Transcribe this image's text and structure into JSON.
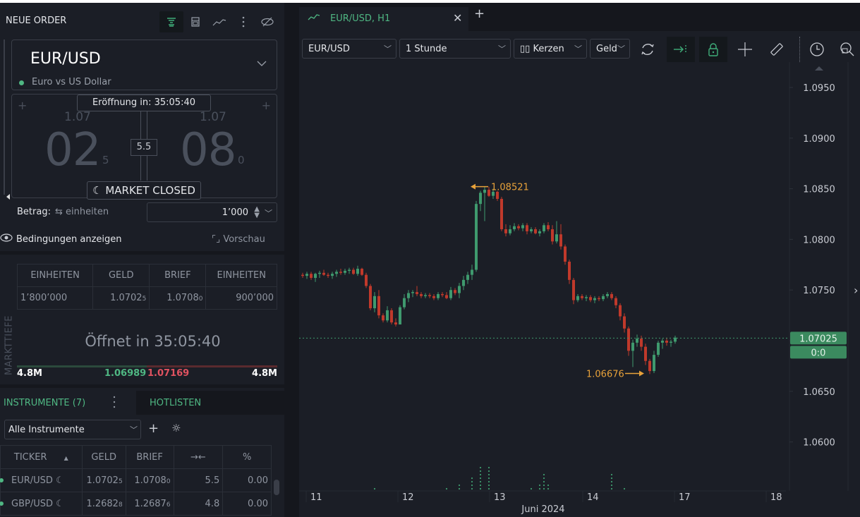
{
  "order_panel": {
    "title": "NEUE ORDER",
    "header_icons": [
      "order-book-icon",
      "calculator-icon",
      "chart-line-icon",
      "more-vertical-icon",
      "hide-eye-icon"
    ],
    "instrument": {
      "symbol": "EUR/USD",
      "description": "Euro vs US Dollar",
      "status_color": "#4fb783"
    },
    "quote": {
      "opening_label": "Eröffnung in: 35:05:40",
      "bid": {
        "prefix": "1.07",
        "pips": "02",
        "fraction": "5"
      },
      "ask": {
        "prefix": "1.07",
        "pips": "08",
        "fraction": "0"
      },
      "spread": "5.5",
      "market_status": "MARKET CLOSED",
      "market_status_icon": "moon-icon"
    },
    "amount": {
      "label": "Betrag:",
      "unit_toggle": "einheiten",
      "value": "1’000"
    },
    "conditions_label": "Bedingungen anzeigen",
    "preview_label": "Vorschau"
  },
  "market_depth": {
    "side_label": "MARKTTIEFE",
    "columns": [
      "EINHEITEN",
      "GELD",
      "BRIEF",
      "EINHEITEN"
    ],
    "rows": [
      {
        "bid_units": "1’800’000",
        "bid": "1.0702",
        "bid_frac": "5",
        "ask": "1.0708",
        "ask_frac": "0",
        "ask_units": "900’000"
      }
    ],
    "opens_in": "Öffnet in 35:05:40",
    "bid_volume": "4.8M",
    "bid_price": "1.06989",
    "ask_price": "1.07169",
    "ask_volume": "4.8M"
  },
  "instruments": {
    "tab_label": "INSTRUMENTE (7)",
    "hotlists_label": "HOTLISTEN",
    "filter": "Alle Instrumente",
    "columns": [
      "TICKER",
      "GELD",
      "BRIEF",
      "→←",
      "%"
    ],
    "rows": [
      {
        "ticker": "EUR/USD",
        "bid": "1.0702",
        "bid_frac": "5",
        "ask": "1.0708",
        "ask_frac": "0",
        "spread": "5.5",
        "change": "0.00"
      },
      {
        "ticker": "GBP/USD",
        "bid": "1.2682",
        "bid_frac": "8",
        "ask": "1.2687",
        "ask_frac": "6",
        "spread": "4.8",
        "change": "0.00"
      }
    ]
  },
  "chart_tab": {
    "label": "EUR/USD, H1"
  },
  "toolbar": {
    "symbol": "EUR/USD",
    "timeframe": "1 Stunde",
    "chart_type": "Kerzen",
    "price_type": "Geld"
  },
  "colors": {
    "up": "#3f9a6e",
    "down": "#c0392b",
    "accent": "#4fb783",
    "annotation": "#e8a23a",
    "price_tag": "#3b8a5f"
  },
  "chart_data": {
    "type": "candlestick",
    "title": "EUR/USD, H1",
    "y_ticks": [
      "1.0950",
      "1.0900",
      "1.0850",
      "1.0800",
      "1.0750",
      "1.0700",
      "1.0650",
      "1.0600"
    ],
    "y_tick_values": [
      1.095,
      1.09,
      1.085,
      1.08,
      1.075,
      1.07,
      1.065,
      1.06
    ],
    "ylim": [
      1.0565,
      1.0975
    ],
    "x_ticks": [
      "11",
      "12",
      "13",
      "14",
      "17",
      "18"
    ],
    "x_label": "Juni 2024",
    "current_price": "1.07025",
    "current_price_value": 1.07025,
    "countdown_tag": "0:0",
    "high_annotation": {
      "label": "1.08521",
      "value": 1.08521
    },
    "low_annotation": {
      "label": "1.06676",
      "value": 1.06676
    },
    "candles": [
      [
        1.0765,
        1.0767,
        1.0762,
        1.0764
      ],
      [
        1.0764,
        1.0768,
        1.0761,
        1.0766
      ],
      [
        1.0766,
        1.0768,
        1.076,
        1.0762
      ],
      [
        1.0762,
        1.0767,
        1.0758,
        1.0766
      ],
      [
        1.0766,
        1.0769,
        1.0762,
        1.0767
      ],
      [
        1.0767,
        1.077,
        1.0764,
        1.0765
      ],
      [
        1.0765,
        1.0767,
        1.0762,
        1.0764
      ],
      [
        1.0764,
        1.0768,
        1.0761,
        1.0766
      ],
      [
        1.0766,
        1.077,
        1.0763,
        1.0768
      ],
      [
        1.0768,
        1.0771,
        1.0765,
        1.0767
      ],
      [
        1.0767,
        1.0771,
        1.0765,
        1.0769
      ],
      [
        1.0769,
        1.0772,
        1.0766,
        1.077
      ],
      [
        1.077,
        1.0772,
        1.0765,
        1.0766
      ],
      [
        1.0766,
        1.0774,
        1.0764,
        1.0771
      ],
      [
        1.0771,
        1.0772,
        1.0764,
        1.0765
      ],
      [
        1.0765,
        1.0767,
        1.0752,
        1.0754
      ],
      [
        1.0754,
        1.0756,
        1.073,
        1.0732
      ],
      [
        1.0732,
        1.0748,
        1.0728,
        1.0744
      ],
      [
        1.0744,
        1.075,
        1.0722,
        1.0725
      ],
      [
        1.0725,
        1.0727,
        1.0718,
        1.072
      ],
      [
        1.072,
        1.0734,
        1.0718,
        1.073
      ],
      [
        1.073,
        1.0732,
        1.0716,
        1.0718
      ],
      [
        1.0718,
        1.0722,
        1.0714,
        1.0716
      ],
      [
        1.0716,
        1.0735,
        1.0716,
        1.0733
      ],
      [
        1.0733,
        1.0746,
        1.0731,
        1.0742
      ],
      [
        1.0742,
        1.075,
        1.0738,
        1.0747
      ],
      [
        1.0747,
        1.075,
        1.0743,
        1.0748
      ],
      [
        1.0748,
        1.0754,
        1.0744,
        1.0746
      ],
      [
        1.0746,
        1.0748,
        1.0742,
        1.0744
      ],
      [
        1.0744,
        1.0747,
        1.0742,
        1.0745
      ],
      [
        1.0745,
        1.0747,
        1.0742,
        1.0744
      ],
      [
        1.0744,
        1.0746,
        1.074,
        1.0742
      ],
      [
        1.0742,
        1.0748,
        1.074,
        1.0746
      ],
      [
        1.0746,
        1.0748,
        1.0743,
        1.0745
      ],
      [
        1.0745,
        1.0748,
        1.0741,
        1.0742
      ],
      [
        1.0742,
        1.0753,
        1.074,
        1.075
      ],
      [
        1.075,
        1.0752,
        1.0745,
        1.0747
      ],
      [
        1.0747,
        1.0757,
        1.0742,
        1.0754
      ],
      [
        1.0754,
        1.0764,
        1.075,
        1.076
      ],
      [
        1.076,
        1.0768,
        1.0756,
        1.0765
      ],
      [
        1.0765,
        1.0775,
        1.076,
        1.077
      ],
      [
        1.077,
        1.0838,
        1.0768,
        1.0835
      ],
      [
        1.0835,
        1.0848,
        1.0828,
        1.0846
      ],
      [
        1.0846,
        1.0852,
        1.0818,
        1.0849
      ],
      [
        1.0849,
        1.0852,
        1.0842,
        1.0843
      ],
      [
        1.0843,
        1.085,
        1.084,
        1.0847
      ],
      [
        1.0847,
        1.0848,
        1.0838,
        1.084
      ],
      [
        1.084,
        1.0842,
        1.0808,
        1.081
      ],
      [
        1.081,
        1.0815,
        1.0803,
        1.0806
      ],
      [
        1.0806,
        1.0814,
        1.0804,
        1.081
      ],
      [
        1.081,
        1.0816,
        1.0808,
        1.0813
      ],
      [
        1.0813,
        1.0815,
        1.0809,
        1.0811
      ],
      [
        1.0811,
        1.0816,
        1.0808,
        1.0814
      ],
      [
        1.0814,
        1.0816,
        1.0805,
        1.0808
      ],
      [
        1.0808,
        1.0812,
        1.0806,
        1.081
      ],
      [
        1.081,
        1.0812,
        1.0805,
        1.0806
      ],
      [
        1.0806,
        1.081,
        1.0803,
        1.0808
      ],
      [
        1.0808,
        1.0816,
        1.0806,
        1.0814
      ],
      [
        1.0814,
        1.0817,
        1.0808,
        1.081
      ],
      [
        1.081,
        1.0814,
        1.0795,
        1.0798
      ],
      [
        1.0798,
        1.0818,
        1.0796,
        1.0805
      ],
      [
        1.0805,
        1.0815,
        1.079,
        1.0793
      ],
      [
        1.0793,
        1.0795,
        1.0775,
        1.0778
      ],
      [
        1.0778,
        1.078,
        1.0756,
        1.076
      ],
      [
        1.076,
        1.0762,
        1.0736,
        1.074
      ],
      [
        1.074,
        1.0746,
        1.0738,
        1.0744
      ],
      [
        1.0744,
        1.0746,
        1.074,
        1.0742
      ],
      [
        1.0742,
        1.0745,
        1.0739,
        1.0743
      ],
      [
        1.0743,
        1.0745,
        1.0738,
        1.074
      ],
      [
        1.074,
        1.0744,
        1.0737,
        1.0742
      ],
      [
        1.0742,
        1.0744,
        1.0739,
        1.0741
      ],
      [
        1.0741,
        1.0746,
        1.0739,
        1.0744
      ],
      [
        1.0744,
        1.0748,
        1.0742,
        1.0746
      ],
      [
        1.0746,
        1.0748,
        1.074,
        1.0742
      ],
      [
        1.0742,
        1.0744,
        1.0732,
        1.0735
      ],
      [
        1.0735,
        1.0737,
        1.072,
        1.0724
      ],
      [
        1.0724,
        1.0727,
        1.0708,
        1.0712
      ],
      [
        1.0712,
        1.0714,
        1.0685,
        1.069
      ],
      [
        1.069,
        1.0701,
        1.0674,
        1.0698
      ],
      [
        1.0698,
        1.0706,
        1.0694,
        1.0702
      ],
      [
        1.0702,
        1.0705,
        1.069,
        1.0694
      ],
      [
        1.0694,
        1.0697,
        1.0676,
        1.068
      ],
      [
        1.068,
        1.0682,
        1.0667,
        1.067
      ],
      [
        1.067,
        1.069,
        1.0668,
        1.0686
      ],
      [
        1.0686,
        1.07,
        1.0684,
        1.0698
      ],
      [
        1.0698,
        1.0702,
        1.0692,
        1.07
      ],
      [
        1.07,
        1.0703,
        1.0695,
        1.0698
      ],
      [
        1.0698,
        1.0701,
        1.0694,
        1.0699
      ],
      [
        1.0699,
        1.0705,
        1.0697,
        1.0703
      ]
    ],
    "volume_ticks": [
      0,
      0,
      0,
      0,
      0,
      0,
      0,
      0,
      0,
      0,
      0,
      0,
      0,
      0,
      0,
      0,
      0,
      1,
      0,
      0,
      0,
      0,
      0,
      0,
      0,
      0,
      0,
      0,
      0,
      0,
      0,
      0,
      0,
      0,
      1,
      0,
      0,
      2,
      0,
      0,
      4,
      0,
      7,
      0,
      7,
      0,
      0,
      0,
      0,
      0,
      0,
      0,
      0,
      0,
      1,
      0,
      2,
      5,
      2,
      0,
      0,
      0,
      0,
      0,
      0,
      0,
      0,
      0,
      0,
      0,
      0,
      0,
      0,
      5,
      0,
      0,
      1,
      0,
      0,
      0,
      0,
      0,
      0,
      0,
      0,
      0,
      0,
      0,
      0,
      0
    ]
  }
}
